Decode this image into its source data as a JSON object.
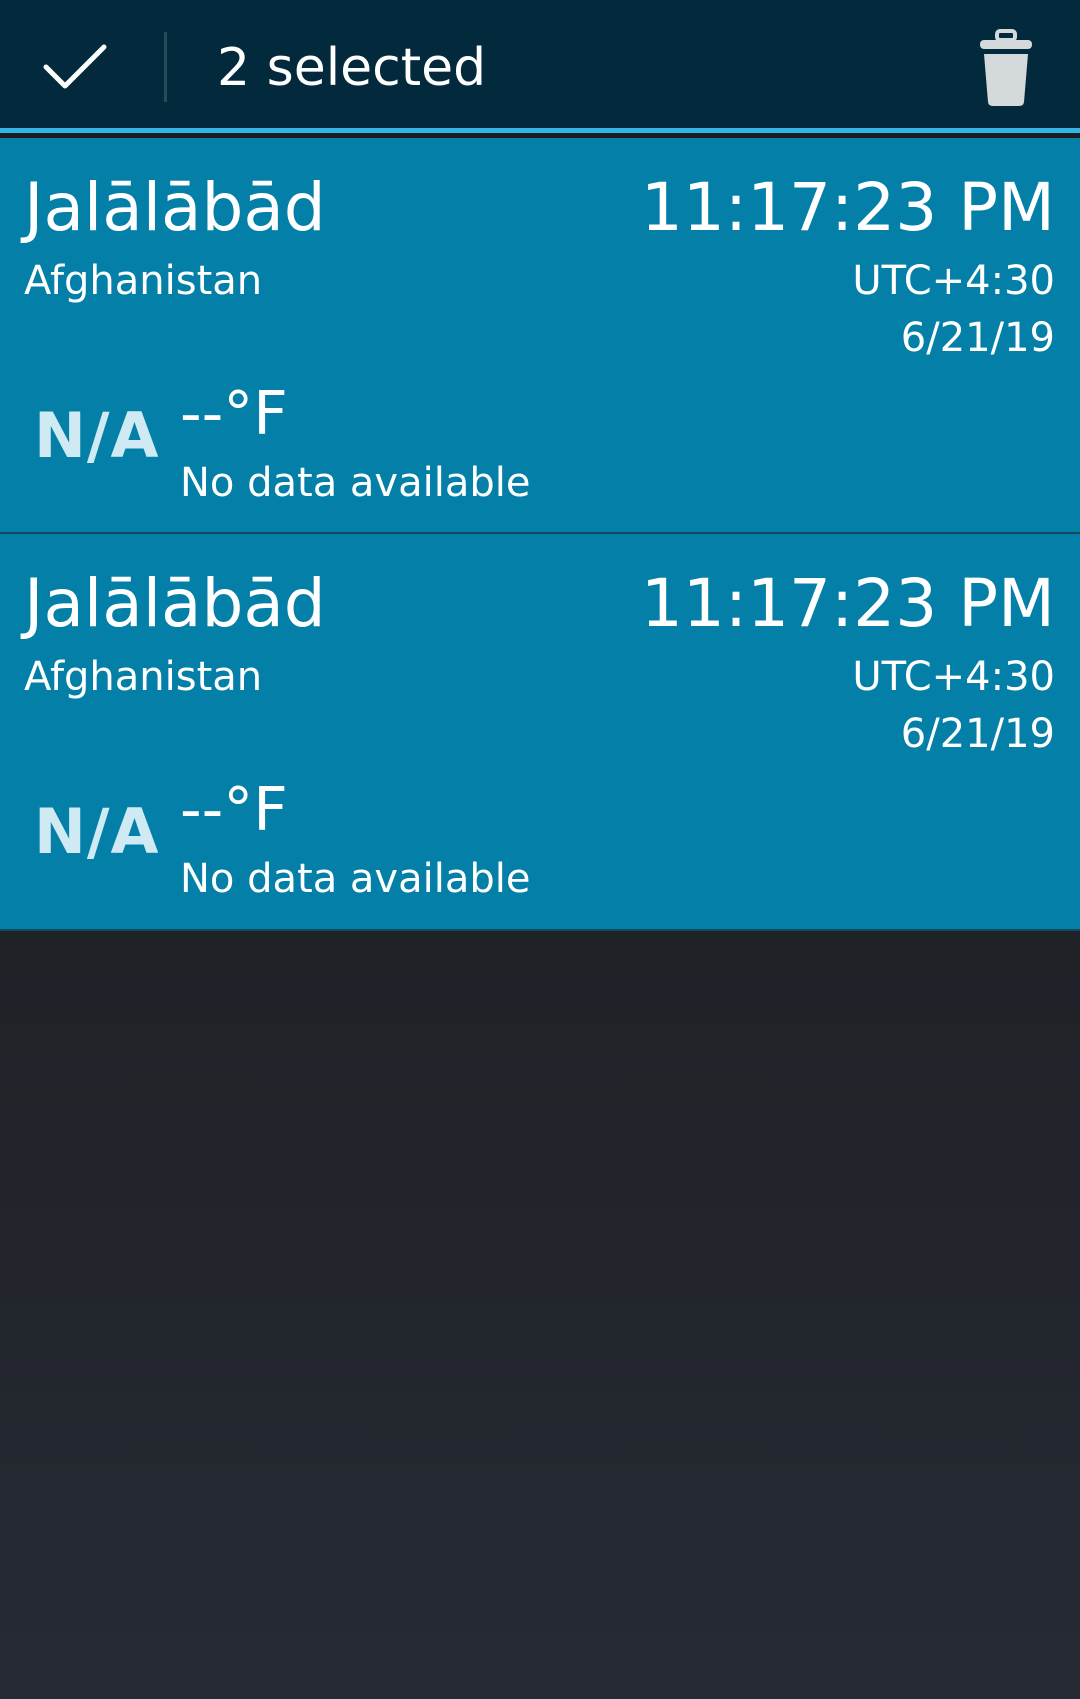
{
  "action_bar": {
    "done_icon": "check-icon",
    "title": "2 selected",
    "delete_icon": "trash-icon",
    "background": "#022a3c",
    "accent": "#33b5e5"
  },
  "cards": [
    {
      "city": "Jalālābād",
      "country": "Afghanistan",
      "time": "11:17:23 PM",
      "timezone": "UTC+4:30",
      "date": "6/21/19",
      "weather_icon_text": "N/A",
      "temperature": "--°F",
      "condition": "No data available"
    },
    {
      "city": "Jalālābād",
      "country": "Afghanistan",
      "time": "11:17:23 PM",
      "timezone": "UTC+4:30",
      "date": "6/21/19",
      "weather_icon_text": "N/A",
      "temperature": "--°F",
      "condition": "No data available"
    }
  ],
  "colors": {
    "card_selected": "#0480a8",
    "card_border": "#114a5c",
    "background": "#1d2024"
  }
}
